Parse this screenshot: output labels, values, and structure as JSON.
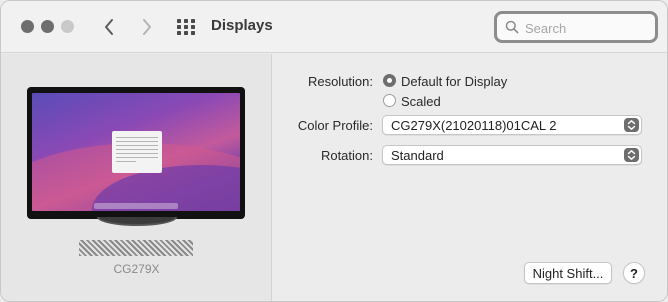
{
  "window": {
    "title": "Displays",
    "search": {
      "placeholder": "Search",
      "value": ""
    }
  },
  "display": {
    "name": "CG279X"
  },
  "settings": {
    "resolution": {
      "label": "Resolution:",
      "options": [
        {
          "label": "Default for Display",
          "selected": true
        },
        {
          "label": "Scaled",
          "selected": false
        }
      ]
    },
    "color_profile": {
      "label": "Color Profile:",
      "value": "CG279X(21020118)01CAL 2"
    },
    "rotation": {
      "label": "Rotation:",
      "value": "Standard"
    }
  },
  "buttons": {
    "night_shift": "Night Shift...",
    "help": "?"
  },
  "icons": {
    "back": "chevron-left-icon",
    "forward": "chevron-right-icon",
    "show_all": "grid-icon",
    "search": "search-icon",
    "popup": "updown-chevron-icon"
  },
  "colors": {
    "window_bg": "#ececec",
    "control_accent": "#6d6d6d"
  }
}
